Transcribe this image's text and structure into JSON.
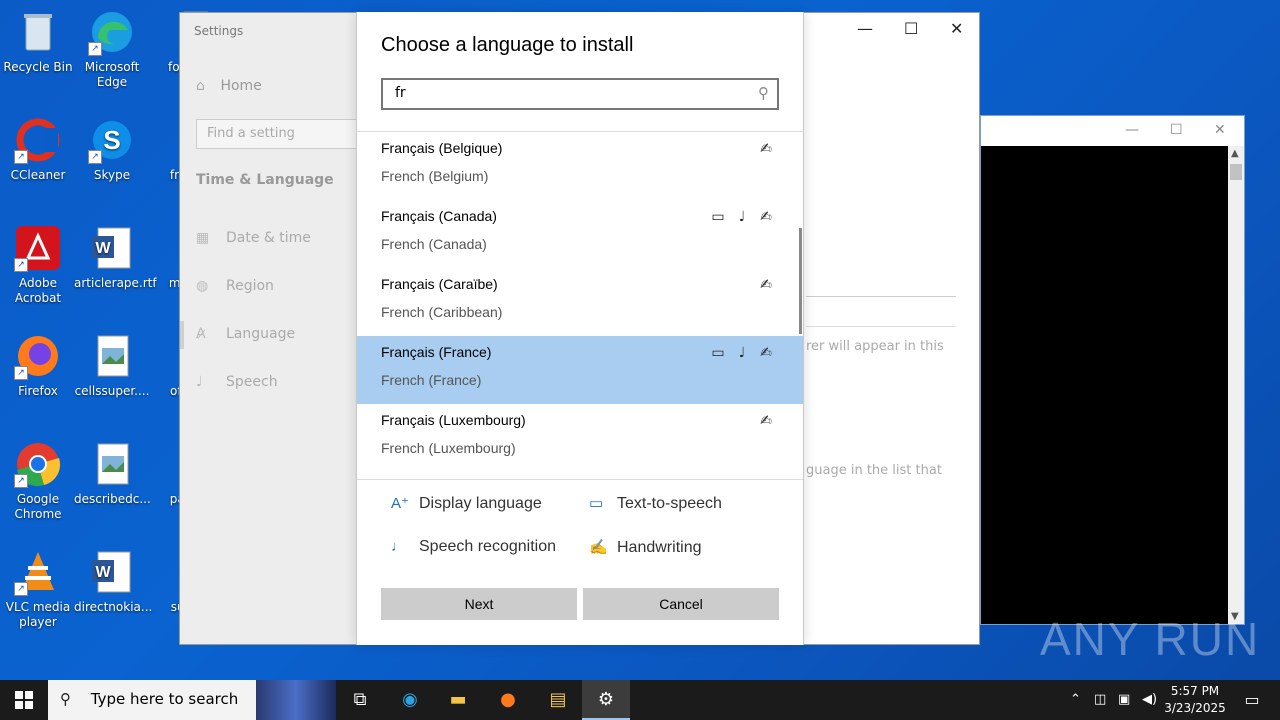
{
  "desktop": {
    "icons": [
      {
        "label": "Recycle Bin",
        "icon": "recycle-bin-icon"
      },
      {
        "label": "Microsoft Edge",
        "icon": "edge-icon"
      },
      {
        "label": "focus",
        "icon": "file-icon"
      },
      {
        "label": "CCleaner",
        "icon": "ccleaner-icon"
      },
      {
        "label": "Skype",
        "icon": "skype-icon"
      },
      {
        "label": "fram",
        "icon": "file-icon"
      },
      {
        "label": "Adobe Acrobat",
        "icon": "acrobat-icon"
      },
      {
        "label": "articlerape.rtf",
        "icon": "word-doc-icon"
      },
      {
        "label": "minu",
        "icon": "word-doc-icon"
      },
      {
        "label": "Firefox",
        "icon": "firefox-icon"
      },
      {
        "label": "cellssuper....",
        "icon": "image-file-icon"
      },
      {
        "label": "offer",
        "icon": "word-doc-icon"
      },
      {
        "label": "Google Chrome",
        "icon": "chrome-icon"
      },
      {
        "label": "describedc...",
        "icon": "image-file-icon"
      },
      {
        "label": "pack",
        "icon": "file-icon"
      },
      {
        "label": "VLC media player",
        "icon": "vlc-icon"
      },
      {
        "label": "directnokia...",
        "icon": "word-doc-icon"
      },
      {
        "label": "subr",
        "icon": "file-icon"
      }
    ]
  },
  "settings": {
    "app_title": "Settings",
    "home": "Home",
    "find_placeholder": "Find a setting",
    "section": "Time & Language",
    "nav_items": [
      "Date & time",
      "Region",
      "Language",
      "Speech"
    ],
    "bg_text_1": "rer will appear in this",
    "bg_text_2": "guage in the list that"
  },
  "dialog": {
    "title": "Choose a language to install",
    "search_value": "fr",
    "languages": [
      {
        "native": "Français (Belgique)",
        "english": "French (Belgium)",
        "features": [
          "handwriting"
        ],
        "selected": false
      },
      {
        "native": "Français (Canada)",
        "english": "French (Canada)",
        "features": [
          "text-to-speech",
          "speech",
          "handwriting"
        ],
        "selected": false
      },
      {
        "native": "Français (Caraïbe)",
        "english": "French (Caribbean)",
        "features": [
          "handwriting"
        ],
        "selected": false
      },
      {
        "native": "Français (France)",
        "english": "French (France)",
        "features": [
          "text-to-speech",
          "speech",
          "handwriting"
        ],
        "selected": true
      },
      {
        "native": "Français (Luxembourg)",
        "english": "French (Luxembourg)",
        "features": [
          "handwriting"
        ],
        "selected": false
      }
    ],
    "legend": {
      "display_language": "Display language",
      "text_to_speech": "Text-to-speech",
      "speech_recognition": "Speech recognition",
      "handwriting": "Handwriting"
    },
    "next_label": "Next",
    "cancel_label": "Cancel"
  },
  "watermark": "ANY RUN",
  "taskbar": {
    "search_placeholder": "Type here to search",
    "time": "5:57 PM",
    "date": "3/23/2025"
  },
  "colors": {
    "selection": "#a8cdf0",
    "accent": "#1f6fc0",
    "desktop": "#0a5cc8"
  }
}
